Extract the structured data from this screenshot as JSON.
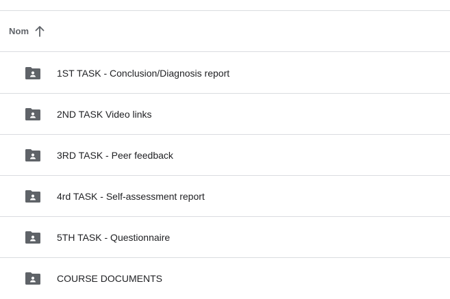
{
  "header": {
    "sort_label": "Nom"
  },
  "folders": [
    {
      "name": "1ST TASK - Conclusion/Diagnosis report"
    },
    {
      "name": "2ND TASK Video links"
    },
    {
      "name": "3RD TASK - Peer feedback"
    },
    {
      "name": "4rd TASK - Self-assessment report"
    },
    {
      "name": "5TH TASK - Questionnaire"
    },
    {
      "name": "COURSE DOCUMENTS"
    }
  ],
  "colors": {
    "folder_icon": "#5f6368",
    "divider": "#dadce0",
    "text": "#202124",
    "header_text": "#5f6368"
  },
  "icons": {
    "folder": "shared-folder-icon",
    "sort": "arrow-upward-icon"
  }
}
